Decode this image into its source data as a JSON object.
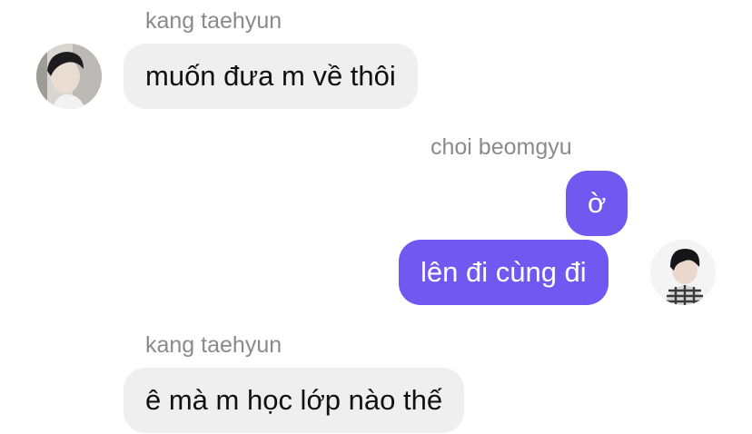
{
  "messages": [
    {
      "sender": "kang taehyun",
      "direction": "incoming",
      "bubbles": [
        "muốn đưa m về thôi"
      ],
      "avatar": "kang-taehyun-avatar"
    },
    {
      "sender": "choi beomgyu",
      "direction": "outgoing",
      "bubbles": [
        "ờ",
        "lên đi cùng đi"
      ],
      "avatar": "choi-beomgyu-avatar"
    },
    {
      "sender": "kang taehyun",
      "direction": "incoming",
      "bubbles": [
        "ê mà m học lớp nào thế"
      ],
      "avatar": null
    }
  ],
  "colors": {
    "incoming_bubble": "#efefef",
    "outgoing_bubble": "#7058f0",
    "sender_label": "#8a8a8e",
    "incoming_text": "#111111",
    "outgoing_text": "#ffffff"
  }
}
